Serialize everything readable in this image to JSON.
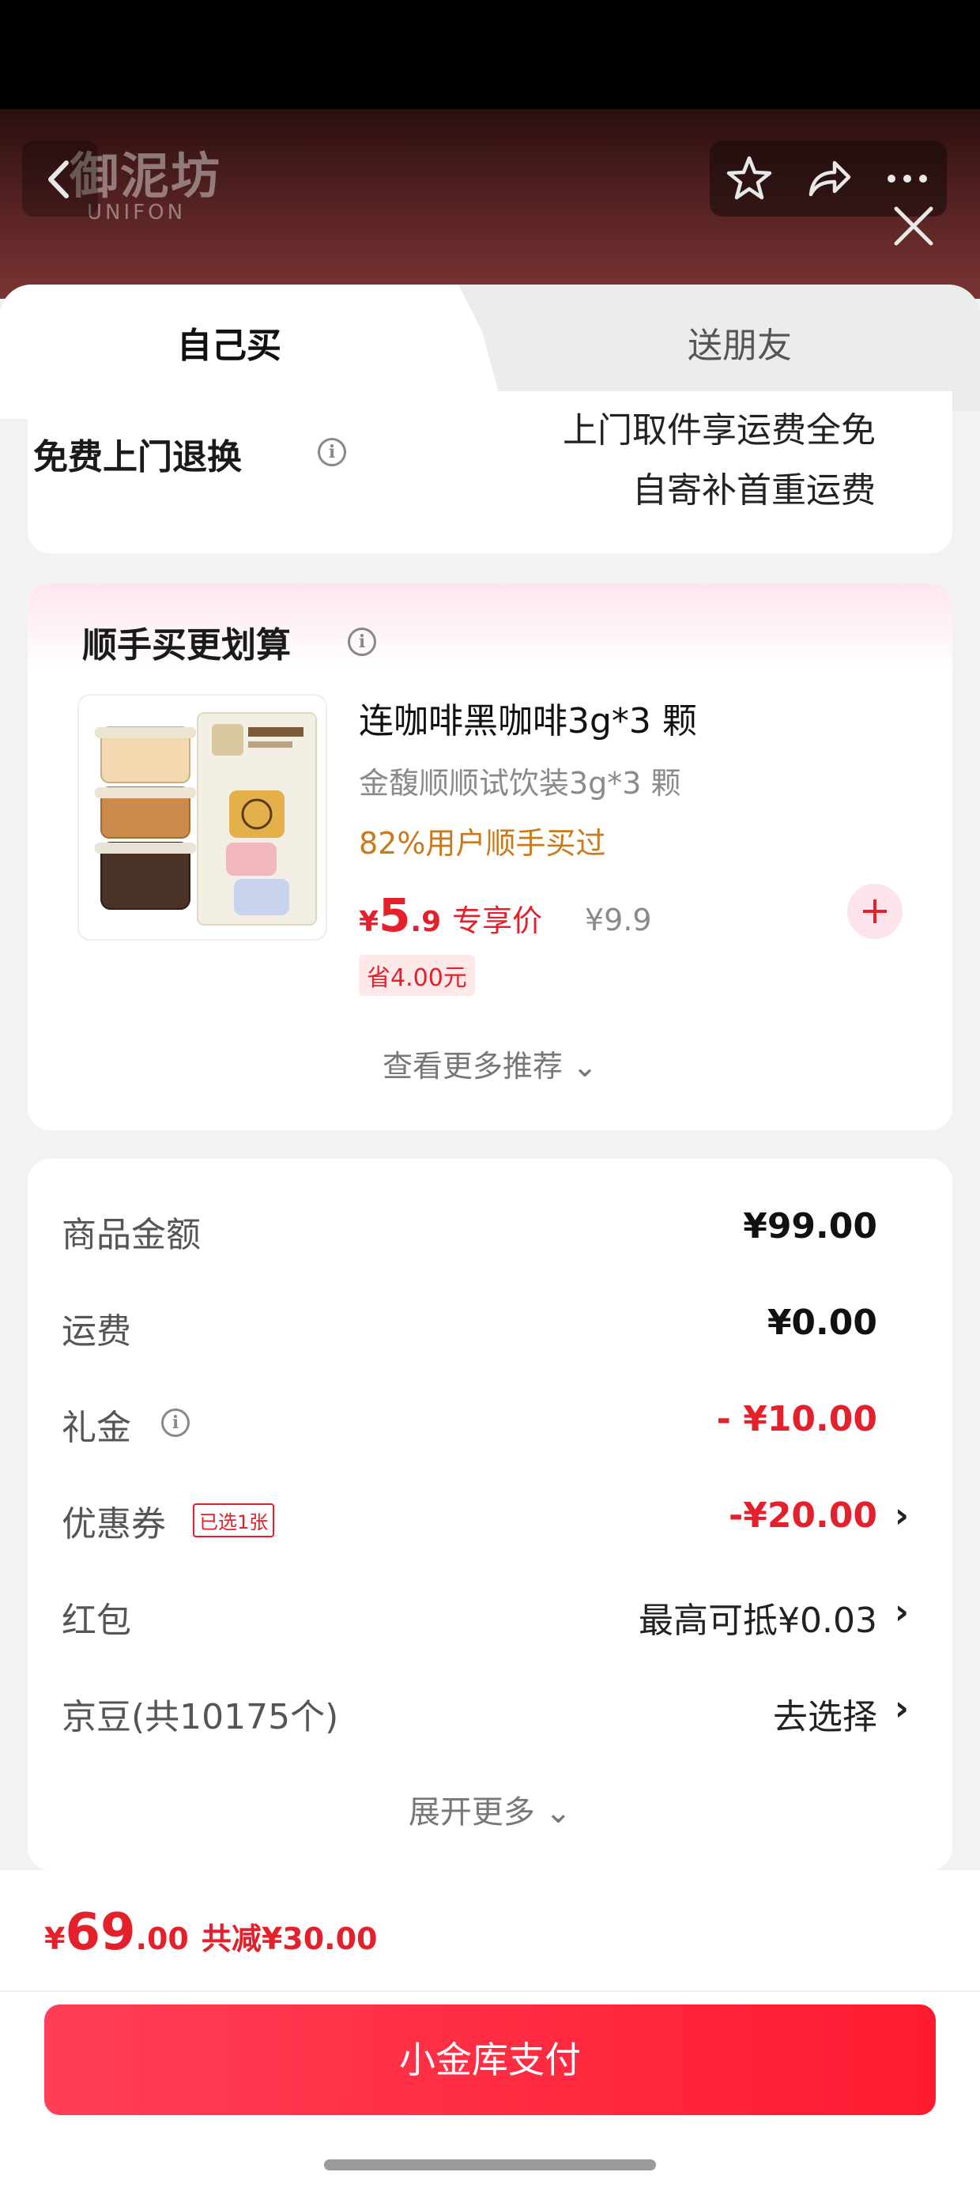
{
  "header": {
    "brand_cn": "御泥坊",
    "brand_en": "UNIFON",
    "icons": [
      "back-arrow-icon",
      "star-icon",
      "share-icon",
      "more-icon",
      "close-icon"
    ]
  },
  "tabs": {
    "self": "自己买",
    "gift": "送朋友"
  },
  "return_service": {
    "label": "免费上门退换",
    "line1": "上门取件享运费全免",
    "line2": "自寄补首重运费"
  },
  "upsell": {
    "title": "顺手买更划算",
    "product": {
      "name": "连咖啡黑咖啡3g*3 颗",
      "subtitle": "金馥顺顺试饮装3g*3 颗",
      "rate": "82%用户顺手买过",
      "price_currency": "¥",
      "price_int": "5",
      "price_dec": ".9",
      "price_tag": "专享价",
      "original_price": "¥9.9",
      "save": "省4.00元"
    },
    "see_more": "查看更多推荐 ⌄"
  },
  "amounts": {
    "goods": {
      "label": "商品金额",
      "value": "¥99.00"
    },
    "shipping": {
      "label": "运费",
      "value": "¥0.00"
    },
    "gift_money": {
      "label": "礼金",
      "value": "- ¥10.00"
    },
    "coupon": {
      "label": "优惠券",
      "badge": "已选1张",
      "value": "-¥20.00"
    },
    "red_packet": {
      "label": "红包",
      "value": "最高可抵¥0.03"
    },
    "jd_beans": {
      "label": "京豆(共10175个)",
      "value": "去选择"
    },
    "expand": "展开更多 ⌄"
  },
  "footer": {
    "total_currency": "¥",
    "total_int": "69",
    "total_dec": ".00",
    "total_reduced": "共减¥30.00",
    "pay_button": "小金库支付"
  },
  "colors": {
    "accent": "#e4202c",
    "rate": "#c97a1c",
    "pay_start": "#ff3f57",
    "pay_end": "#ff1a2f"
  }
}
